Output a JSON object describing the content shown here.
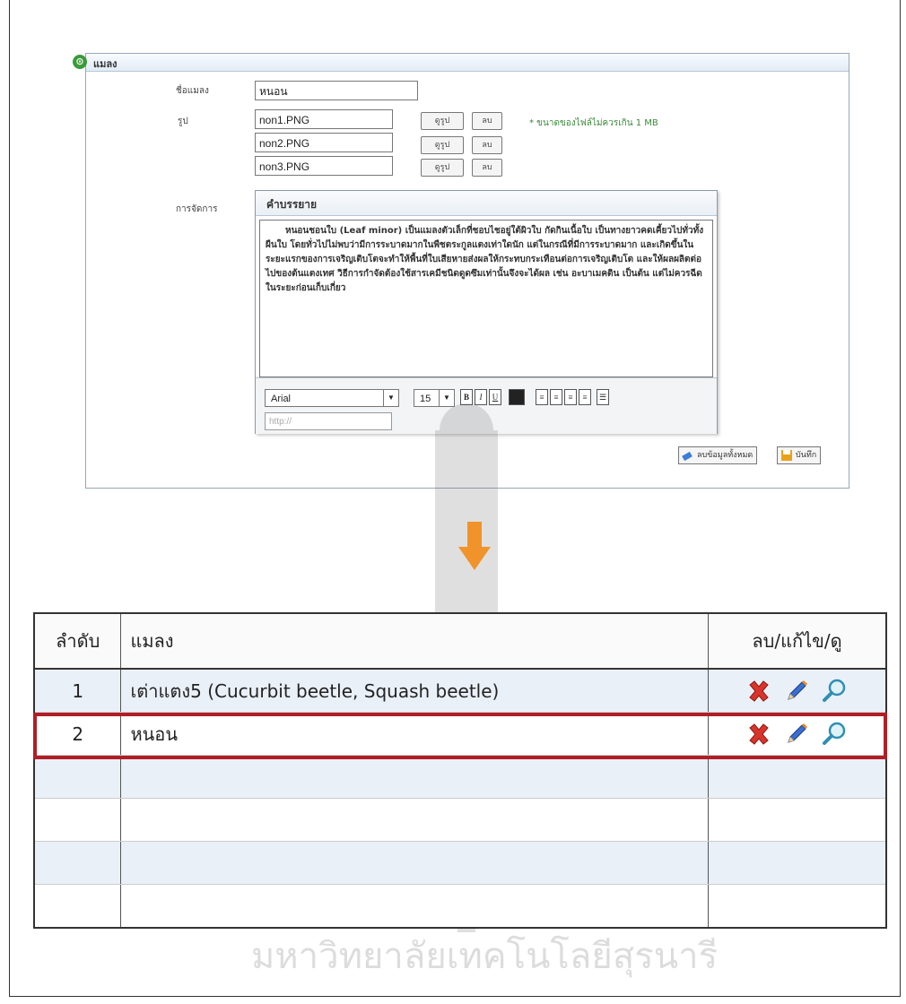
{
  "form": {
    "title": "แมลง",
    "name_label": "ชื่อแมลง",
    "name_value": "หนอน",
    "image_label": "รูป",
    "images": [
      "non1.PNG",
      "non2.PNG",
      "non3.PNG"
    ],
    "view_button": "ดูรูป",
    "delete_button": "ลบ",
    "size_note": "* ขนาดของไฟล์ไม่ควรเกิน 1 MB",
    "manage_label": "การจัดการ",
    "description_heading": "คำบรรยาย",
    "description_text": "หนอนชอนใบ (Leaf minor) เป็นแมลงตัวเล็กที่ชอบไชอยู่ใต้ผิวใบ กัดกินเนื้อใบ เป็นทางยาวคดเคี้ยวไปทั่วทั้งผืนใบ โดยทั่วไปไม่พบว่ามีการระบาดมากในพืชตระกูลแตงเท่าใดนัก แต่ในกรณีที่มีการระบาดมาก และเกิดขึ้นในระยะแรกของการเจริญเติบโตจะทำให้พื้นที่ใบเสียหายส่งผลให้กระทบกระเทือนต่อการเจริญเติบโต และให้ผลผลิตต่อไปของต้นแตงเทศ วิธีการกำจัดต้องใช้สารเคมีชนิดดูดซึมเท่านั้นจึงจะได้ผล เช่น อะบาเมคติน เป็นต้น แต่ไม่ควรฉีดในระยะก่อนเก็บเกี่ยว",
    "font_value": "Arial",
    "size_value": "15",
    "url_placeholder": "http://",
    "clear_button": "ลบข้อมูลทั้งหมด",
    "save_button": "บันทึก"
  },
  "table": {
    "headers": [
      "ลำดับ",
      "แมลง",
      "ลบ/แก้ไข/ดู"
    ],
    "rows": [
      {
        "no": "1",
        "name": "เต่าแตง5 (Cucurbit beetle, Squash beetle)"
      },
      {
        "no": "2",
        "name": "หนอน"
      }
    ]
  },
  "colors": {
    "highlight": "#b01e26",
    "row_alt": "#eaf0f8",
    "arrow": "#f0932b"
  },
  "watermark": {
    "line1": "มหาวิทยาลัยเทคโนโลยีสุรนารี"
  }
}
